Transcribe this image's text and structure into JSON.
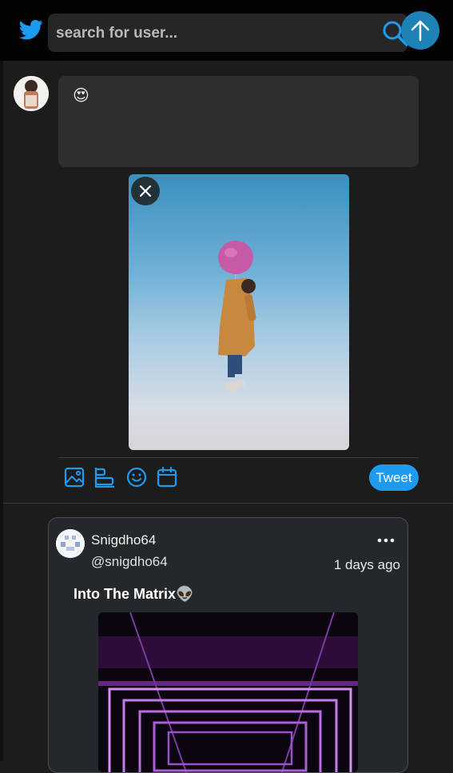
{
  "header": {
    "search_placeholder": "search for user...",
    "brand_color": "#1d9bf0"
  },
  "composer": {
    "text": "😍",
    "tweet_label": "Tweet",
    "toolbar_icons": [
      "image-icon",
      "poll-icon",
      "emoji-icon",
      "schedule-icon"
    ]
  },
  "feed": {
    "posts": [
      {
        "display_name": "Snigdho64",
        "handle": "@snigdho64",
        "time": "1 days ago",
        "text": "Into The Matrix👽"
      }
    ]
  }
}
